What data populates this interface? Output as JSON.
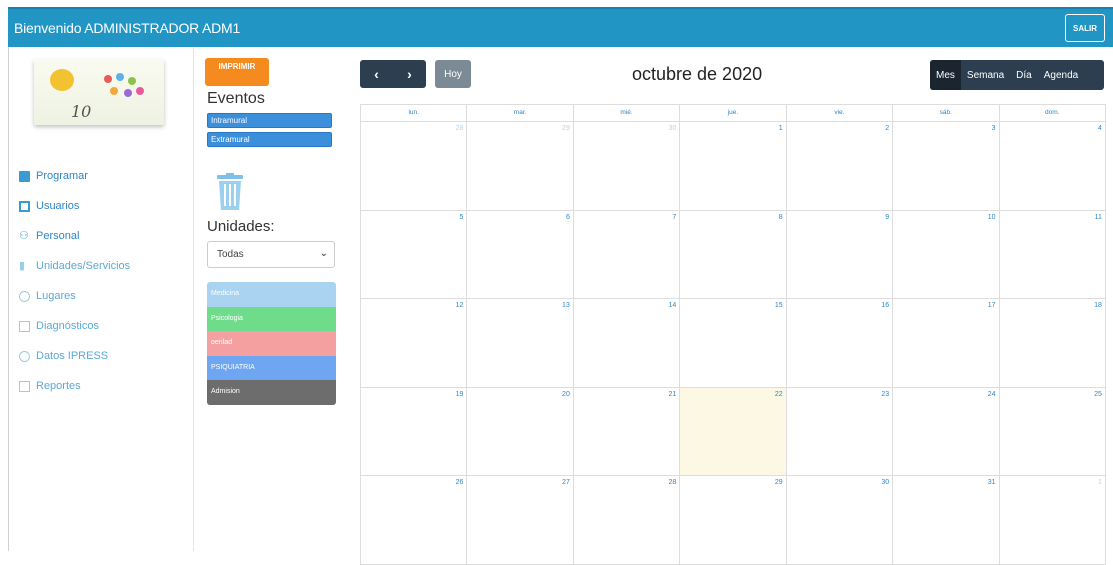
{
  "header": {
    "welcome": "Bienvenido ADMINISTRADOR ADM1",
    "logout_label": "SALIR"
  },
  "sidebar": {
    "logo_ten": "10",
    "items": [
      {
        "label": "Programar",
        "icon": "calendar-icon"
      },
      {
        "label": "Usuarios",
        "icon": "user-icon"
      },
      {
        "label": "Personal",
        "icon": "people-icon"
      },
      {
        "label": "Unidades/Servicios",
        "icon": "chart-icon"
      },
      {
        "label": "Lugares",
        "icon": "location-icon"
      },
      {
        "label": "Diagnósticos",
        "icon": "document-icon"
      },
      {
        "label": "Datos IPRESS",
        "icon": "info-icon"
      },
      {
        "label": "Reportes",
        "icon": "document-icon"
      }
    ]
  },
  "panel": {
    "print_label": "IMPRIMIR",
    "events_title": "Eventos",
    "events": [
      "Intramural",
      "Extramural"
    ],
    "units_label": "Unidades:",
    "units_selected": "Todas",
    "units": [
      {
        "label": "Medicina",
        "color": "#a9d3f0"
      },
      {
        "label": "Psicologia",
        "color": "#6fdc8c"
      },
      {
        "label": "oenlad",
        "color": "#f5a0a0"
      },
      {
        "label": "PSIQUIATRIA",
        "color": "#6ea6f2"
      },
      {
        "label": "Admision",
        "color": "#6d6d6d"
      }
    ]
  },
  "calendar": {
    "today_label": "Hoy",
    "title": "octubre de 2020",
    "views": [
      "Mes",
      "Semana",
      "Día",
      "Agenda"
    ],
    "active_view": "Mes",
    "weekdays": [
      "lun.",
      "mar.",
      "mié.",
      "jue.",
      "vie.",
      "sáb.",
      "dom."
    ],
    "weeks": [
      [
        {
          "d": "28",
          "o": true
        },
        {
          "d": "29",
          "o": true
        },
        {
          "d": "30",
          "o": true
        },
        {
          "d": "1"
        },
        {
          "d": "2"
        },
        {
          "d": "3"
        },
        {
          "d": "4"
        }
      ],
      [
        {
          "d": "5"
        },
        {
          "d": "6"
        },
        {
          "d": "7"
        },
        {
          "d": "8"
        },
        {
          "d": "9"
        },
        {
          "d": "10"
        },
        {
          "d": "11"
        }
      ],
      [
        {
          "d": "12"
        },
        {
          "d": "13"
        },
        {
          "d": "14"
        },
        {
          "d": "15"
        },
        {
          "d": "16"
        },
        {
          "d": "17"
        },
        {
          "d": "18"
        }
      ],
      [
        {
          "d": "19"
        },
        {
          "d": "20"
        },
        {
          "d": "21"
        },
        {
          "d": "22",
          "t": true
        },
        {
          "d": "23"
        },
        {
          "d": "24"
        },
        {
          "d": "25"
        }
      ],
      [
        {
          "d": "26"
        },
        {
          "d": "27"
        },
        {
          "d": "28"
        },
        {
          "d": "29"
        },
        {
          "d": "30"
        },
        {
          "d": "31"
        },
        {
          "d": "1",
          "o": true
        }
      ]
    ]
  }
}
